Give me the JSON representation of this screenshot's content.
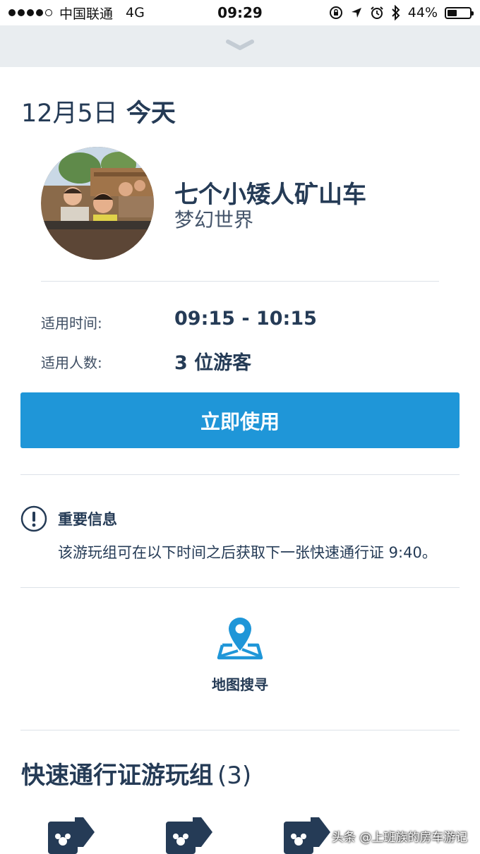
{
  "status_bar": {
    "carrier": "中国联通",
    "network": "4G",
    "time": "09:29",
    "battery": "44%",
    "battery_level": 0.44
  },
  "header": {
    "date": "12月5日",
    "day_label": "今天"
  },
  "attraction": {
    "name": "七个小矮人矿山车",
    "land": "梦幻世界"
  },
  "details": [
    {
      "label": "适用时间:",
      "value": "09:15 - 10:15"
    },
    {
      "label": "适用人数:",
      "value": "3 位游客"
    }
  ],
  "primary_action": {
    "label": "立即使用",
    "color": "#1f96d8"
  },
  "notice": {
    "icon": "exclamation-circle-icon",
    "title": "重要信息",
    "body": "该游玩组可在以下时间之后获取下一张快速通行证 9:40。"
  },
  "map": {
    "icon": "map-pin-icon",
    "label": "地图搜寻",
    "color": "#1f96d8"
  },
  "group_section": {
    "title": "快速通行证游玩组",
    "count": "(3)",
    "pass_icon": "ticket-icon"
  },
  "watermark": "头条 @上班族的房车游记",
  "colors": {
    "text_primary": "#253b56",
    "handle_bar": "#e9edf0",
    "divider": "#dde2e8"
  }
}
